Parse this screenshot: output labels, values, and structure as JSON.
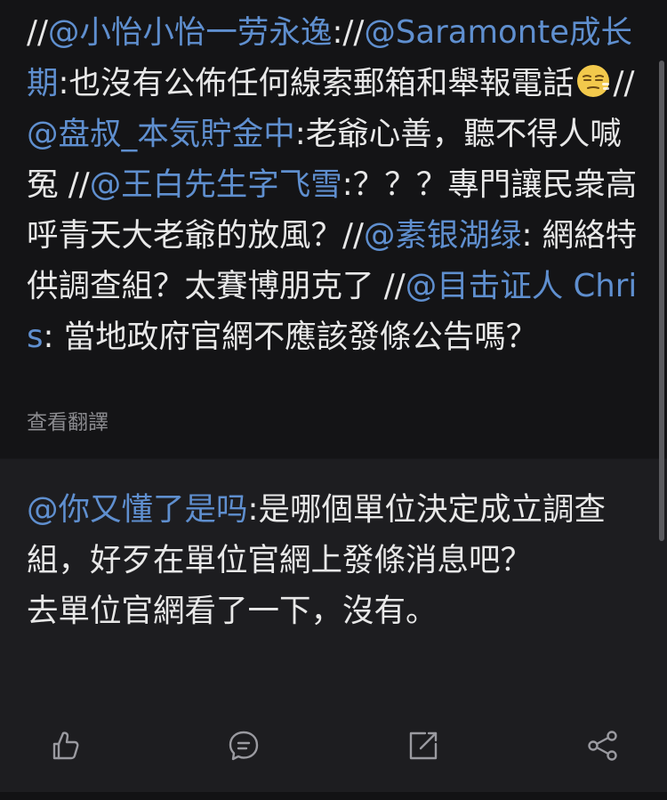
{
  "post": {
    "segments": [
      {
        "type": "plain",
        "text": "//"
      },
      {
        "type": "mention",
        "text": "@小怡小怡一劳永逸"
      },
      {
        "type": "plain",
        "text": "://"
      },
      {
        "type": "mention",
        "text": "@Saramonte成长期"
      },
      {
        "type": "plain",
        "text": ":也沒有公佈任何線索郵箱和舉報電話"
      },
      {
        "type": "emoji",
        "name": "smirk-emoji"
      },
      {
        "type": "plain",
        "text": "//"
      },
      {
        "type": "mention",
        "text": "@盘叔_本気貯金中"
      },
      {
        "type": "plain",
        "text": ":老爺心善，聽不得人喊冤 //"
      },
      {
        "type": "mention",
        "text": "@王白先生字飞雪"
      },
      {
        "type": "plain",
        "text": ":？？？專門讓民衆高呼青天大老爺的放風？//"
      },
      {
        "type": "mention",
        "text": "@素银湖绿"
      },
      {
        "type": "plain",
        "text": ": 網絡特供調查組？太賽博朋克了 //"
      },
      {
        "type": "mention",
        "text": "@目击证人 Chris"
      },
      {
        "type": "plain",
        "text": ": 當地政府官網不應該發條公告嗎？"
      }
    ],
    "translate_label": "查看翻譯"
  },
  "repost": {
    "mention": "@你又懂了是吗",
    "text_line1": ":是哪個單位決定成立調查組，好歹在單位官網上發條消息吧？",
    "text_line2": "去單位官網看了一下，沒有。"
  },
  "actions": [
    {
      "name": "like-icon"
    },
    {
      "name": "comment-icon"
    },
    {
      "name": "repost-icon"
    },
    {
      "name": "share-icon"
    }
  ],
  "colors": {
    "mention": "#5f8fcf",
    "text": "#e8e8e8",
    "muted": "#8a8a8e",
    "background": "#141416",
    "card": "#1d1d20"
  }
}
